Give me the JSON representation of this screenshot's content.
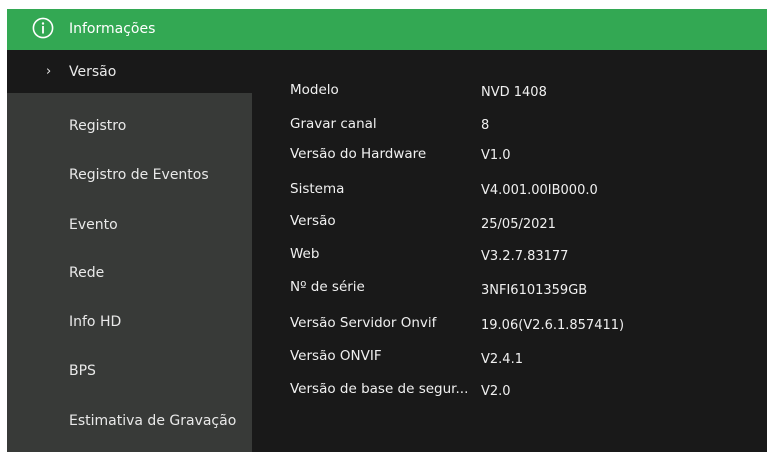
{
  "title": "Informações",
  "sidebar": {
    "items": [
      {
        "label": "Versão",
        "active": true
      },
      {
        "label": "Registro"
      },
      {
        "label": "Registro de Eventos"
      },
      {
        "label": "Evento"
      },
      {
        "label": "Rede"
      },
      {
        "label": "Info HD"
      },
      {
        "label": "BPS"
      },
      {
        "label": "Estimativa de Gravação"
      }
    ],
    "active_marker": "›"
  },
  "info": [
    {
      "label": "Modelo",
      "value": "NVD 1408"
    },
    {
      "label": "Gravar canal",
      "value": "8"
    },
    {
      "label": "Versão do Hardware",
      "value": "V1.0"
    },
    {
      "label": "Sistema",
      "value": "V4.001.00IB000.0"
    },
    {
      "label": "Versão",
      "value": "25/05/2021"
    },
    {
      "label": "Web",
      "value": "V3.2.7.83177"
    },
    {
      "label": "Nº de série",
      "value": "3NFI6101359GB"
    },
    {
      "label": "Versão Servidor Onvif",
      "value": "19.06(V2.6.1.857411)"
    },
    {
      "label": "Versão ONVIF",
      "value": "V2.4.1"
    },
    {
      "label": "Versão de base de segur...",
      "value": "V2.0"
    }
  ],
  "colors": {
    "titlebar": "#33a853",
    "sidebar": "#383a38",
    "content": "#191919",
    "text": "#f0f0f0"
  },
  "icons": {
    "title": "info-icon",
    "active": "chevron-right-icon"
  }
}
